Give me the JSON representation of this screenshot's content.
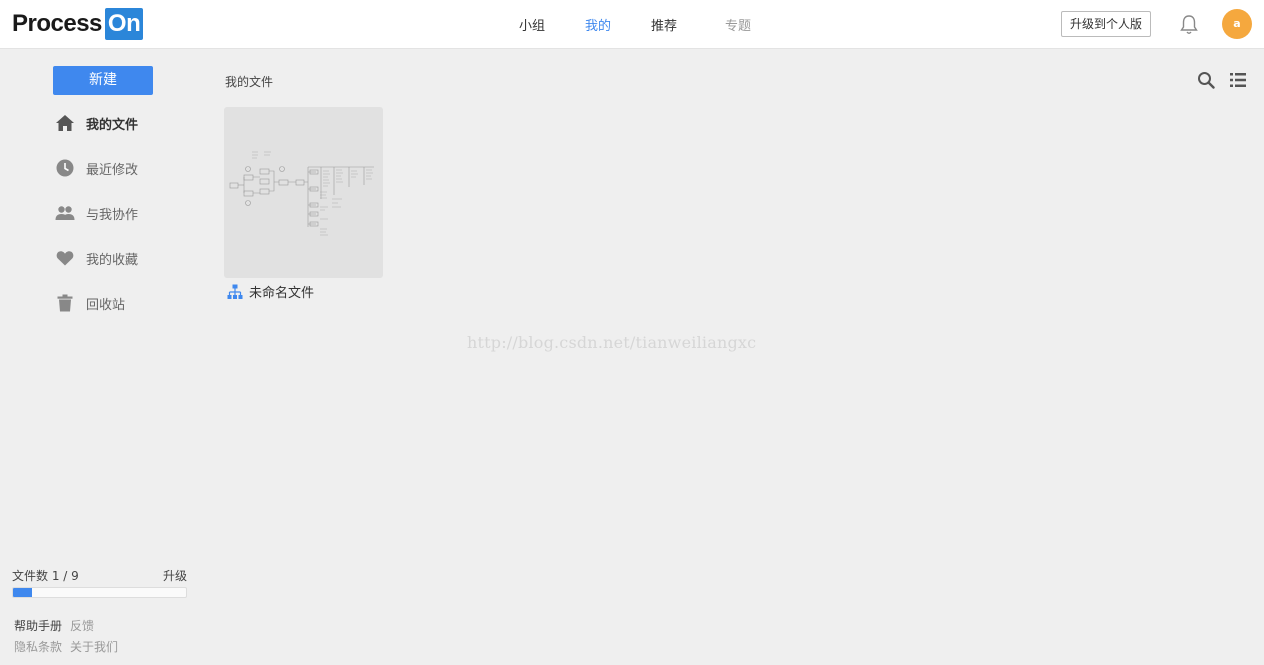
{
  "header": {
    "logo_part1": "Process",
    "logo_part2": "On",
    "nav": [
      {
        "label": "小组",
        "color": "#333333"
      },
      {
        "label": "我的",
        "color": "#3f88ee"
      },
      {
        "label": "推荐",
        "color": "#333333"
      },
      {
        "label": "专题",
        "color": "#999999"
      }
    ],
    "upgrade_label": "升级到个人版",
    "avatar_text": "a"
  },
  "sidebar": {
    "new_label": "新建",
    "items": [
      {
        "label": "我的文件",
        "icon": "home-icon",
        "active": true
      },
      {
        "label": "最近修改",
        "icon": "clock-icon"
      },
      {
        "label": "与我协作",
        "icon": "people-icon"
      },
      {
        "label": "我的收藏",
        "icon": "heart-icon"
      },
      {
        "label": "回收站",
        "icon": "trash-icon"
      }
    ],
    "quota_label": "文件数 1 / 9",
    "quota_upgrade": "升级",
    "quota_fraction": 0.111,
    "footer": {
      "help": "帮助手册",
      "feedback": "反馈",
      "privacy": "隐私条款",
      "about": "关于我们"
    }
  },
  "main": {
    "breadcrumb": "我的文件",
    "files": [
      {
        "title": "未命名文件",
        "icon": "org-chart-icon"
      }
    ]
  },
  "watermark": "http://blog.csdn.net/tianweiliangxc",
  "colors": {
    "accent": "#3f88ee",
    "background": "#efefef",
    "avatar": "#f5a83e"
  }
}
